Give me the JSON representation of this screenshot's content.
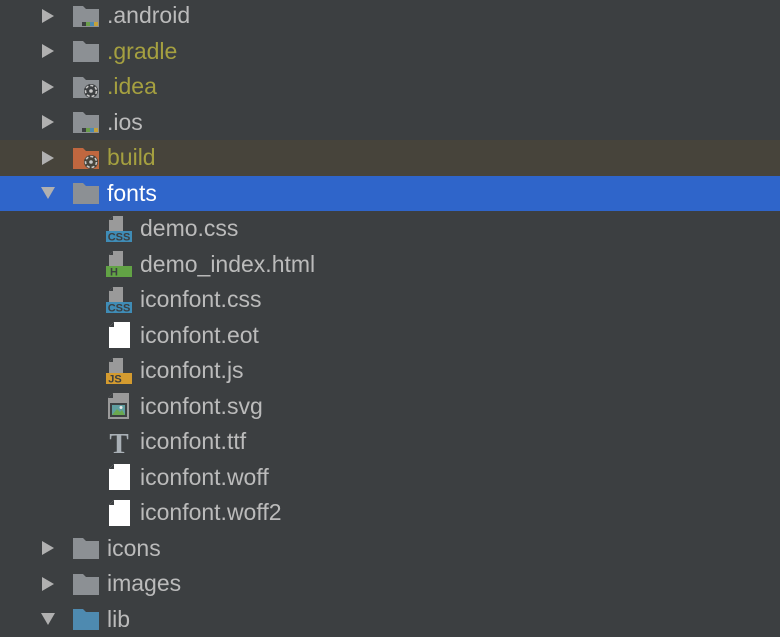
{
  "tree": {
    "items": [
      {
        "label": ".android",
        "type": "folder-module",
        "expanded": false
      },
      {
        "label": ".gradle",
        "type": "folder",
        "expanded": false,
        "color": "#a5a040"
      },
      {
        "label": ".idea",
        "type": "folder-idea",
        "expanded": false,
        "color": "#a5a040"
      },
      {
        "label": ".ios",
        "type": "folder-module",
        "expanded": false
      },
      {
        "label": "build",
        "type": "folder-excluded",
        "expanded": false,
        "color": "#a5a040"
      },
      {
        "label": "fonts",
        "type": "folder",
        "expanded": true,
        "selected": true
      },
      {
        "label": "demo.css",
        "type": "css-file"
      },
      {
        "label": "demo_index.html",
        "type": "html-file"
      },
      {
        "label": "iconfont.css",
        "type": "css-file"
      },
      {
        "label": "iconfont.eot",
        "type": "plain-file"
      },
      {
        "label": "iconfont.js",
        "type": "js-file"
      },
      {
        "label": "iconfont.svg",
        "type": "image-file"
      },
      {
        "label": "iconfont.ttf",
        "type": "font-file"
      },
      {
        "label": "iconfont.woff",
        "type": "plain-file"
      },
      {
        "label": "iconfont.woff2",
        "type": "plain-file"
      },
      {
        "label": "icons",
        "type": "folder",
        "expanded": false
      },
      {
        "label": "images",
        "type": "folder",
        "expanded": false
      },
      {
        "label": "lib",
        "type": "folder-source",
        "expanded": true
      }
    ]
  },
  "icon_text": {
    "css": "CSS",
    "html": "H",
    "js": "JS",
    "font": "T"
  },
  "colors": {
    "background": "#3c3f41",
    "selection": "#2f65ca",
    "excluded_row": "#47443b",
    "text": "#bbbbbb",
    "ignored_text": "#a5a040",
    "folder": "#8c9094",
    "excluded_folder": "#c0673f",
    "source_folder": "#4e8ab0"
  }
}
